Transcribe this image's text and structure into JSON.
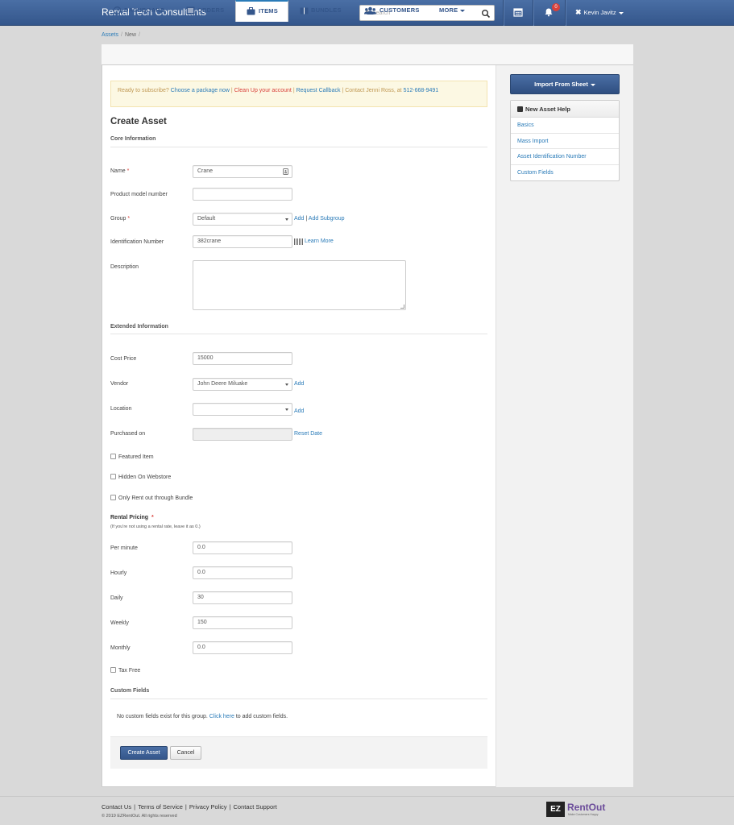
{
  "app": {
    "brand": "Rental Tech Consultants",
    "search_placeholder": "Search",
    "notification_count": "0",
    "user_name": "Kevin Javitz"
  },
  "breadcrumb": {
    "root": "Assets",
    "current": "New"
  },
  "tabs": [
    {
      "label": "DASHBOARD",
      "icon": "dashboard-icon"
    },
    {
      "label": "ORDERS",
      "icon": "orders-icon"
    },
    {
      "label": "ITEMS",
      "icon": "briefcase-icon",
      "active": true
    },
    {
      "label": "BUNDLES",
      "icon": "bundles-icon"
    },
    {
      "label": "CUSTOMERS",
      "icon": "users-icon"
    },
    {
      "label": "MORE",
      "icon": "chevron-down-icon"
    }
  ],
  "alert": {
    "prefix": "Ready to subscribe?",
    "choose": "Choose a package now",
    "sep1": " | ",
    "cleanup": "Clean Up your account",
    "sep2": " | ",
    "callback": "Request Callback",
    "contact": " | Contact Jenni Ross, at ",
    "phone": "512-668-9491"
  },
  "form": {
    "title": "Create Asset",
    "core_heading": "Core Information",
    "name_label": "Name",
    "name_value": "Crane",
    "model_label": "Product model number",
    "model_value": "",
    "group_label": "Group",
    "group_value": "Default",
    "group_add": "Add",
    "group_sep": " | ",
    "group_add_sub": "Add Subgroup",
    "id_label": "Identification Number",
    "id_value": "382crane",
    "id_learn": "Learn More",
    "desc_label": "Description",
    "required_mark": "*",
    "ext_heading": "Extended Information",
    "cost_label": "Cost Price",
    "cost_value": "15000",
    "vendor_label": "Vendor",
    "vendor_value": "John Deere Miluake",
    "vendor_add": "Add",
    "location_label": "Location",
    "location_value": "",
    "location_add": "Add",
    "purchased_label": "Purchased on",
    "purchased_value": "",
    "reset_date": "Reset Date",
    "featured": "Featured Item",
    "hidden": "Hidden On Webstore",
    "bundle_only": "Only Rent out through Bundle",
    "pricing_heading": "Rental Pricing",
    "pricing_note": "(If you're not using a rental rate, leave it as 0.)",
    "per_minute_label": "Per minute",
    "per_minute_value": "0.0",
    "hourly_label": "Hourly",
    "hourly_value": "0.0",
    "daily_label": "Daily",
    "daily_value": "30",
    "weekly_label": "Weekly",
    "weekly_value": "150",
    "monthly_label": "Monthly",
    "monthly_value": "0.0",
    "tax_free": "Tax Free",
    "custom_heading": "Custom Fields",
    "custom_text_1": "No custom fields exist for this group. ",
    "custom_link": "Click here",
    "custom_text_2": " to add custom fields.",
    "submit": "Create Asset",
    "cancel": "Cancel"
  },
  "sidebar": {
    "import_button": "Import From Sheet",
    "help_title": "New Asset Help",
    "help_items": [
      "Basics",
      "Mass Import",
      "Asset Identification Number",
      "Custom Fields"
    ]
  },
  "footer": {
    "links": [
      "Contact Us",
      "Terms of Service",
      "Privacy Policy",
      "Contact Support"
    ],
    "copyright": "© 2019 EZRentOut. All rights reserved",
    "logo_ez": "EZ",
    "logo_name": "RentOut",
    "logo_tag": "Make Customers Happy"
  },
  "colors": {
    "primary": "#34568b",
    "link": "#2a7bb8",
    "danger": "#d9403a",
    "alert_bg": "#fcf8e3",
    "logo": "#6b4c9a"
  }
}
